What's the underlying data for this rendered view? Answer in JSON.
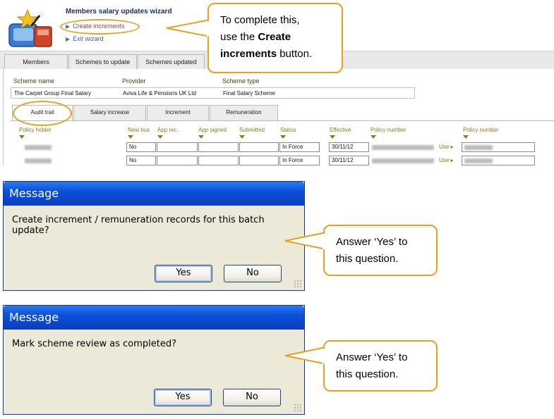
{
  "wizard": {
    "title": "Members salary updates wizard",
    "links": [
      {
        "label": "Create increments"
      },
      {
        "label": "Exit wizard"
      }
    ],
    "top_tabs": [
      "Members",
      "Schemes to update",
      "Schemes updated"
    ],
    "scheme": {
      "labels": {
        "name": "Scheme name",
        "provider": "Provider",
        "type": "Scheme type"
      },
      "values": {
        "name": "The Carpet Group Final Salary",
        "provider": "Aviva Life & Pensions UK Ltd",
        "type": "Final Salary Scheme"
      }
    },
    "inner_tabs": [
      "Audit trail",
      "Salary increase",
      "Increment",
      "Remuneration"
    ],
    "columns": [
      "Policy holder",
      "New bus",
      "App rec.",
      "App signed",
      "Submitted",
      "Status",
      "Effective",
      "Policy number",
      "Policy number"
    ],
    "rows": [
      {
        "new_bus": "No",
        "status": "In Force",
        "effective": "30/11/12",
        "use": "Use"
      },
      {
        "new_bus": "No",
        "status": "In Force",
        "effective": "30/11/12",
        "use": "Use"
      }
    ]
  },
  "callouts": {
    "top": {
      "line1": "To complete this,",
      "line2_pre": "use the ",
      "line2_bold": "Create",
      "line3_bold": "increments",
      "line3_post": " button."
    },
    "dialog1": {
      "line1": "Answer ‘Yes’ to",
      "line2": "this question."
    },
    "dialog2": {
      "line1": "Answer ‘Yes’ to",
      "line2": "this question."
    }
  },
  "dialogs": [
    {
      "title": "Message",
      "message": "Create increment / remuneration records for this batch update?",
      "yes": "Yes",
      "no": "No"
    },
    {
      "title": "Message",
      "message": "Mark scheme review as completed?",
      "yes": "Yes",
      "no": "No"
    }
  ],
  "colors": {
    "accent_outline": "#e8a020",
    "titlebar": "#0a50d8",
    "dialog_bg": "#ece9d8",
    "link_red": "#c0392b",
    "link_blue": "#3b5ea8"
  }
}
